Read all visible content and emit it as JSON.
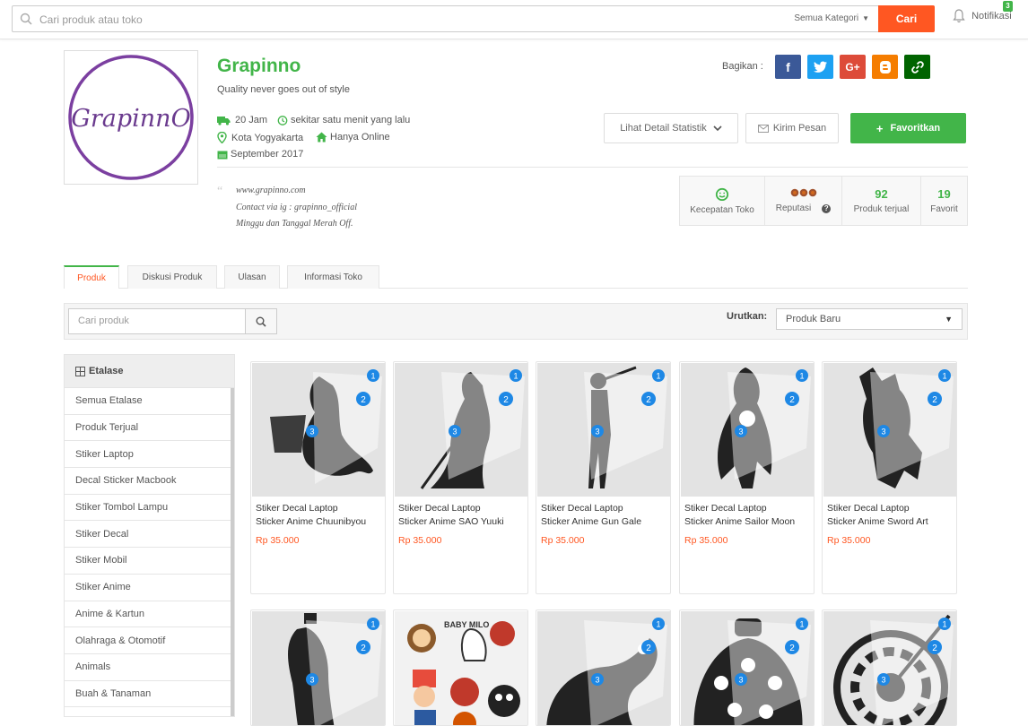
{
  "topbar": {
    "search_placeholder": "Cari produk atau toko",
    "category": "Semua Kategori",
    "search_button": "Cari",
    "notifications_label": "Notifikasi",
    "notifications_count": "3"
  },
  "shop": {
    "logo_text": "GrapinnO",
    "name": "Grapinno",
    "tagline": "Quality never goes out of style",
    "share_label": "Bagikan :",
    "share_buttons": [
      "f",
      "t",
      "G+",
      "b",
      "link"
    ],
    "response_time": "20 Jam",
    "last_online": "sekitar satu menit yang lalu",
    "city": "Kota Yogyakarta",
    "online_type": "Hanya Online",
    "joined": "September 2017",
    "stats_button": "Lihat Detail Statistik",
    "message_button": "Kirim Pesan",
    "favorite_button": "Favoritkan",
    "description": [
      "www.grapinno.com",
      "Contact via ig : grapinno_official",
      "Minggu dan Tanggal Merah Off."
    ],
    "stats": {
      "speed_label": "Kecepatan Toko",
      "reputation_label": "Reputasi",
      "sold_value": "92",
      "sold_label": "Produk terjual",
      "favorite_value": "19",
      "favorite_label": "Favorit"
    }
  },
  "tabs": [
    "Produk",
    "Diskusi Produk",
    "Ulasan",
    "Informasi Toko"
  ],
  "filter": {
    "search_placeholder": "Cari produk",
    "sort_label": "Urutkan:",
    "sort_value": "Produk Baru"
  },
  "sidebar": {
    "title": "Etalase",
    "items": [
      "Semua Etalase",
      "Produk Terjual",
      "Stiker Laptop",
      "Decal Sticker Macbook",
      "Stiker Tombol Lampu",
      "Stiker Decal",
      "Stiker Mobil",
      "Stiker Anime",
      "Anime & Kartun",
      "Olahraga & Otomotif",
      "Animals",
      "Buah & Tanaman"
    ]
  },
  "products": [
    {
      "name_line1": "Stiker Decal Laptop",
      "name_line2": "Sticker Anime Chuunibyou",
      "price": "Rp 35.000"
    },
    {
      "name_line1": "Stiker Decal Laptop",
      "name_line2": "Sticker Anime SAO Yuuki",
      "price": "Rp 35.000"
    },
    {
      "name_line1": "Stiker Decal Laptop",
      "name_line2": "Sticker Anime Gun Gale",
      "price": "Rp 35.000"
    },
    {
      "name_line1": "Stiker Decal Laptop",
      "name_line2": "Sticker Anime Sailor Moon",
      "price": "Rp 35.000"
    },
    {
      "name_line1": "Stiker Decal Laptop",
      "name_line2": "Sticker Anime Sword Art",
      "price": "Rp 35.000"
    }
  ],
  "colors": {
    "brand_green": "#42b549",
    "accent_orange": "#ff5722",
    "badge_blue": "#1e88e5"
  }
}
